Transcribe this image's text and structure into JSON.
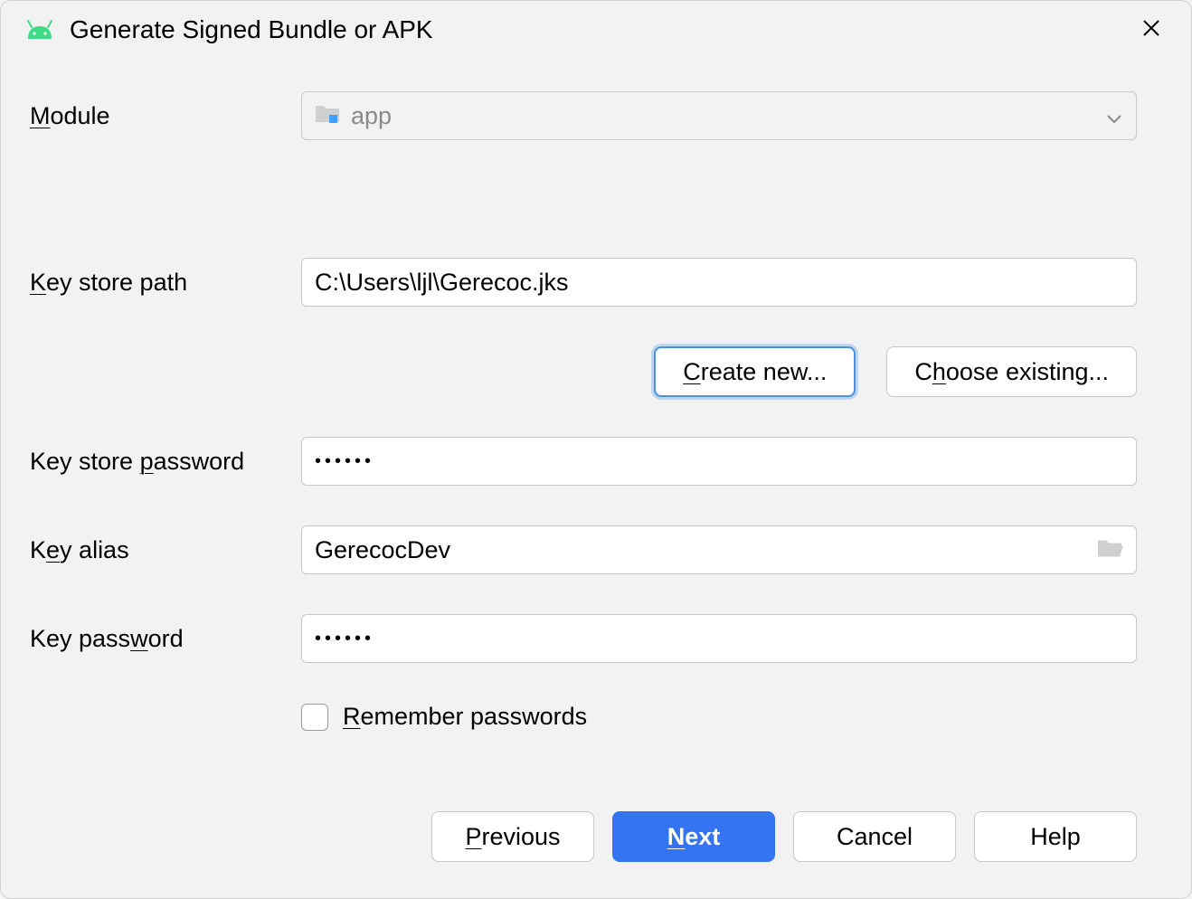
{
  "title": "Generate Signed Bundle or APK",
  "labels": {
    "module_pre": "M",
    "module_post": "odule",
    "keystorepath_pre": "K",
    "keystorepath_post": "ey store path",
    "keystorepassword_pre": "Key store ",
    "keystorepassword_u": "p",
    "keystorepassword_post": "assword",
    "keyalias_pre": "K",
    "keyalias_u": "e",
    "keyalias_post": "y alias",
    "keypassword_pre": "Key pass",
    "keypassword_u": "w",
    "keypassword_post": "ord",
    "remember_pre": "R",
    "remember_post": "emember passwords"
  },
  "module": {
    "selected": "app"
  },
  "keystore": {
    "path": "C:\\Users\\ljl\\Gerecoc.jks",
    "password": "••••••"
  },
  "key": {
    "alias": "GerecocDev",
    "password": "••••••"
  },
  "buttons": {
    "create_pre": "C",
    "create_post": "reate new...",
    "choose_pre": "C",
    "choose_u": "h",
    "choose_post": "oose existing...",
    "previous_pre": "P",
    "previous_post": "revious",
    "next_pre": "N",
    "next_post": "ext",
    "cancel": "Cancel",
    "help": "Help"
  },
  "remember_checked": false
}
